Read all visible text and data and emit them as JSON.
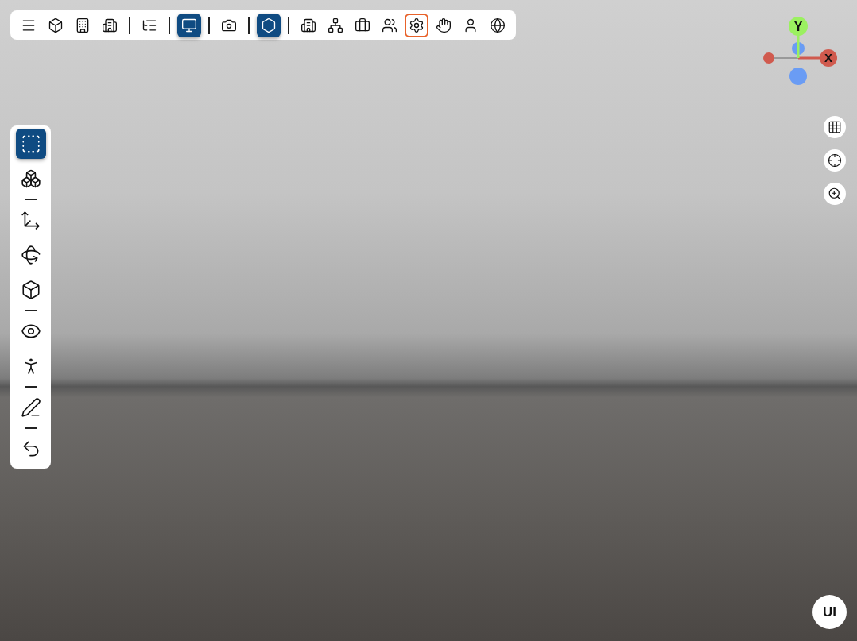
{
  "top_toolbar": {
    "items": [
      {
        "kind": "button",
        "selected": false,
        "focused": false
      },
      {
        "kind": "button",
        "selected": false,
        "focused": false
      },
      {
        "kind": "button",
        "selected": false,
        "focused": false
      },
      {
        "kind": "button",
        "selected": false,
        "focused": false
      },
      {
        "kind": "separator"
      },
      {
        "kind": "button",
        "selected": false,
        "focused": false
      },
      {
        "kind": "separator"
      },
      {
        "kind": "button",
        "selected": true,
        "focused": false
      },
      {
        "kind": "separator"
      },
      {
        "kind": "button",
        "selected": false,
        "focused": false
      },
      {
        "kind": "separator"
      },
      {
        "kind": "button",
        "selected": true,
        "focused": false
      },
      {
        "kind": "separator"
      },
      {
        "kind": "button",
        "selected": false,
        "focused": false
      },
      {
        "kind": "button",
        "selected": false,
        "focused": false
      },
      {
        "kind": "button",
        "selected": false,
        "focused": false
      },
      {
        "kind": "button",
        "selected": false,
        "focused": false
      },
      {
        "kind": "button",
        "selected": false,
        "focused": true
      },
      {
        "kind": "button",
        "selected": false,
        "focused": false
      },
      {
        "kind": "button",
        "selected": false,
        "focused": false
      },
      {
        "kind": "button",
        "selected": false,
        "focused": false
      }
    ]
  },
  "left_toolbar": {
    "items": [
      {
        "kind": "button",
        "selected": true
      },
      {
        "kind": "button",
        "selected": false
      },
      {
        "kind": "separator"
      },
      {
        "kind": "button",
        "selected": false
      },
      {
        "kind": "button",
        "selected": false
      },
      {
        "kind": "button",
        "selected": false
      },
      {
        "kind": "separator"
      },
      {
        "kind": "button",
        "selected": false
      },
      {
        "kind": "button",
        "selected": false
      },
      {
        "kind": "separator"
      },
      {
        "kind": "button",
        "selected": false
      },
      {
        "kind": "separator"
      },
      {
        "kind": "button",
        "selected": false
      }
    ]
  },
  "axis_gizmo": {
    "y_label": "Y",
    "x_label": "X"
  },
  "view_controls": {
    "items": [
      {
        "selected": false
      },
      {
        "selected": false
      },
      {
        "selected": false
      }
    ]
  },
  "ui_button": {
    "label": "UI"
  }
}
